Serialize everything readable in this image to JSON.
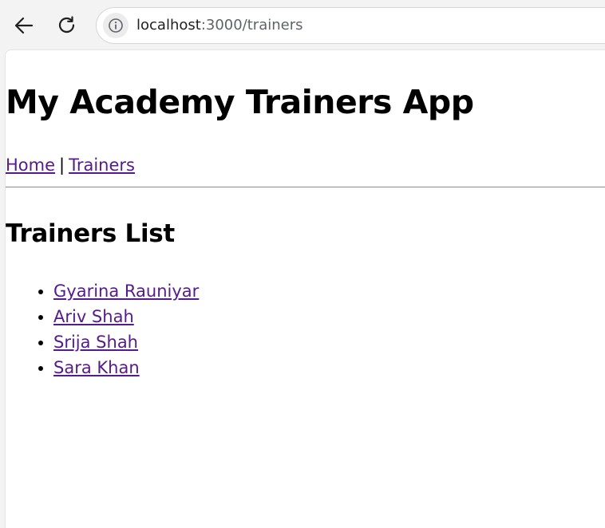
{
  "browser": {
    "url_host": "localhost",
    "url_path": ":3000/trainers"
  },
  "page": {
    "title": "My Academy Trainers App",
    "nav": {
      "home_label": "Home",
      "separator": "|",
      "trainers_label": "Trainers"
    },
    "section_title": "Trainers List",
    "trainers": [
      {
        "name": "Gyarina Rauniyar"
      },
      {
        "name": "Ariv Shah"
      },
      {
        "name": "Srija Shah"
      },
      {
        "name": "Sara Khan"
      }
    ]
  },
  "colors": {
    "link_visited": "#551a8b",
    "text": "#000000",
    "chrome_bg": "#f3f3f3"
  },
  "icons": {
    "back": "arrow-left-icon",
    "reload": "reload-icon",
    "site_info": "info-icon"
  }
}
